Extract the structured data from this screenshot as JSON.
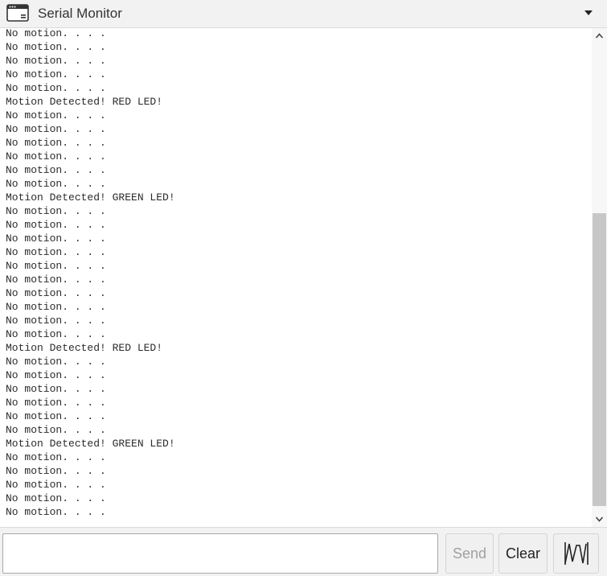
{
  "window": {
    "title": "Serial Monitor",
    "icon": "window-icon",
    "menu_icon": "dropdown-arrow-icon"
  },
  "output": {
    "lines": [
      "No motion. . . .",
      "No motion. . . .",
      "No motion. . . .",
      "No motion. . . .",
      "No motion. . . .",
      "Motion Detected! RED LED!",
      "No motion. . . .",
      "No motion. . . .",
      "No motion. . . .",
      "No motion. . . .",
      "No motion. . . .",
      "No motion. . . .",
      "Motion Detected! GREEN LED!",
      "No motion. . . .",
      "No motion. . . .",
      "No motion. . . .",
      "No motion. . . .",
      "No motion. . . .",
      "No motion. . . .",
      "No motion. . . .",
      "No motion. . . .",
      "No motion. . . .",
      "No motion. . . .",
      "Motion Detected! RED LED!",
      "No motion. . . .",
      "No motion. . . .",
      "No motion. . . .",
      "No motion. . . .",
      "No motion. . . .",
      "No motion. . . .",
      "Motion Detected! GREEN LED!",
      "No motion. . . .",
      "No motion. . . .",
      "No motion. . . .",
      "No motion. . . .",
      "No motion. . . ."
    ]
  },
  "input": {
    "value": "",
    "placeholder": ""
  },
  "buttons": {
    "send": "Send",
    "clear": "Clear",
    "plotter_icon": "serial-plotter-icon"
  },
  "colors": {
    "bar_background": "#f2f2f2",
    "text": "#2b2b2b",
    "disabled_text": "#a0a0a0",
    "scroll_thumb": "#c7c7c7"
  }
}
